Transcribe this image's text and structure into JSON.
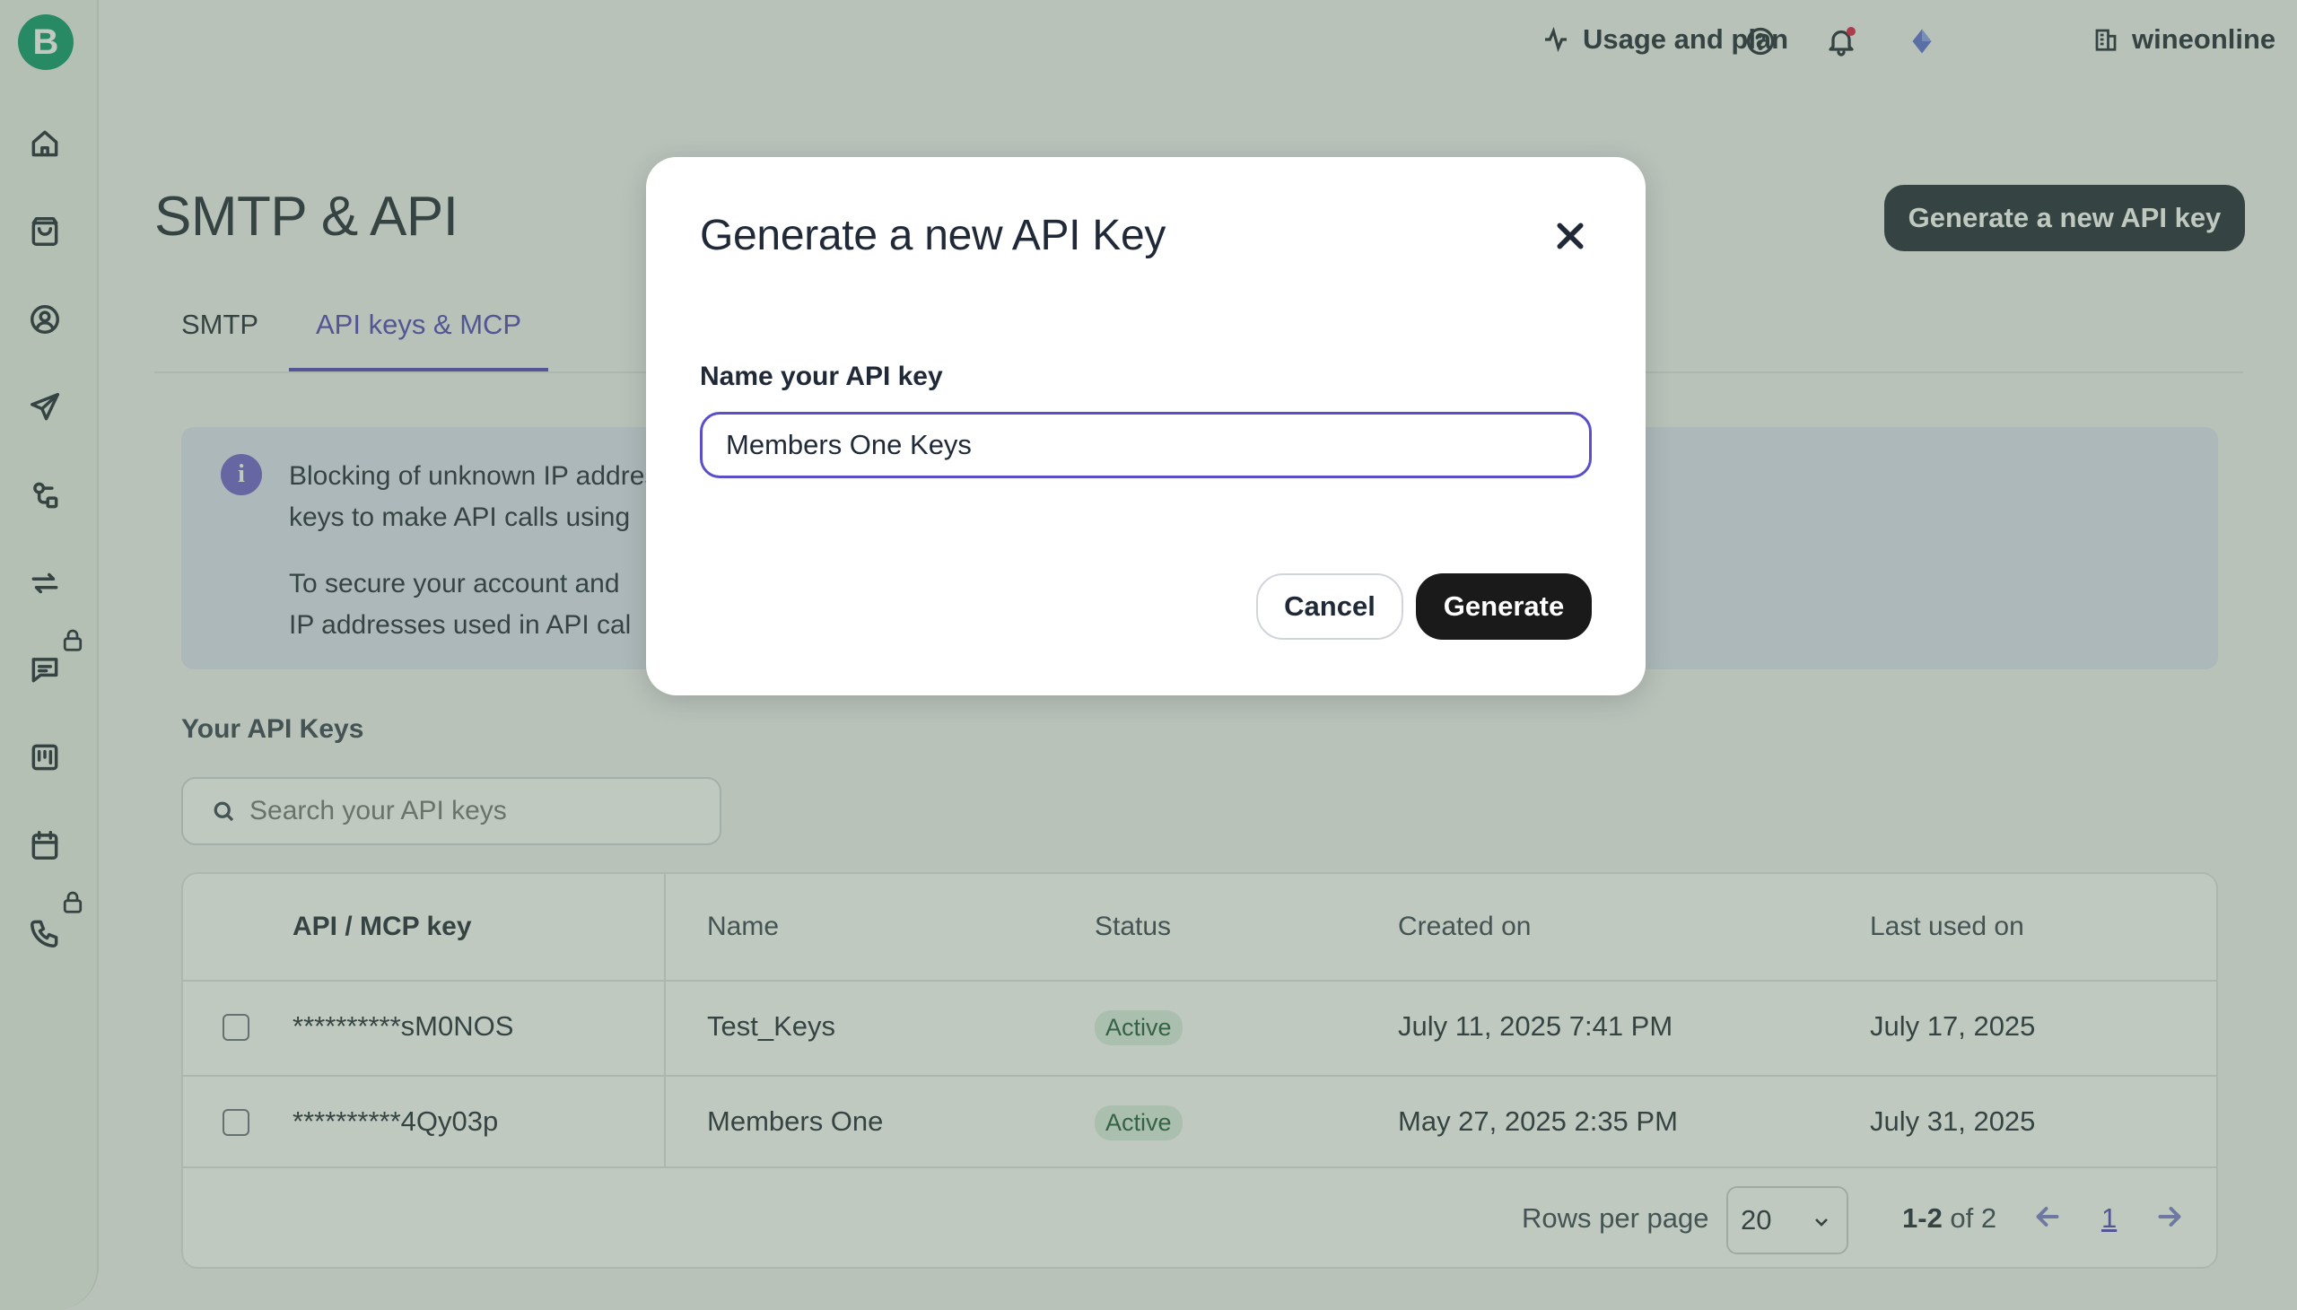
{
  "app": {
    "logo_letter": "B"
  },
  "sidebar": {
    "items": [
      {
        "icon": "home-icon"
      },
      {
        "icon": "shopping-bag-icon"
      },
      {
        "icon": "contacts-icon"
      },
      {
        "icon": "send-icon"
      },
      {
        "icon": "automation-icon"
      },
      {
        "icon": "sync-icon"
      },
      {
        "icon": "chat-icon",
        "locked": true
      },
      {
        "icon": "board-icon"
      },
      {
        "icon": "calendar-icon"
      },
      {
        "icon": "phone-icon",
        "locked": true
      }
    ]
  },
  "header": {
    "usage_label": "Usage and plan",
    "org_name": "wineonline"
  },
  "page": {
    "title": "SMTP & API",
    "primary_button": "Generate a new API key",
    "tabs": [
      {
        "label": "SMTP",
        "active": false
      },
      {
        "label": "API keys & MCP",
        "active": true
      }
    ],
    "info": {
      "line1": "Blocking of unknown IP addresses is now available. You can allow the IP addresses used with API",
      "line2": "keys to make API calls using",
      "line3": "To secure your account and",
      "line4": "IP addresses used in API cal"
    },
    "section_title": "Your API Keys",
    "search_placeholder": "Search your API keys"
  },
  "table": {
    "headers": [
      "API / MCP key",
      "Name",
      "Status",
      "Created on",
      "Last used on"
    ],
    "rows": [
      {
        "key": "**********sM0NOS",
        "name": "Test_Keys",
        "status": "Active",
        "created": "July 11, 2025 7:41 PM",
        "last_used": "July 17, 2025"
      },
      {
        "key": "**********4Qy03p",
        "name": "Members One",
        "status": "Active",
        "created": "May 27, 2025 2:35 PM",
        "last_used": "July 31, 2025"
      }
    ],
    "rows_per_page_label": "Rows per page",
    "rows_per_page_value": "20",
    "range_bold": "1-2",
    "range_rest": " of 2",
    "current_page": "1"
  },
  "modal": {
    "title": "Generate a new API Key",
    "field_label": "Name your API key",
    "field_value": "Members One Keys",
    "cancel_label": "Cancel",
    "generate_label": "Generate"
  },
  "colors": {
    "accent": "#4f46b8",
    "overlay": "#5a7056",
    "logo": "#0b996e",
    "badge_bg": "#dcefe4"
  }
}
